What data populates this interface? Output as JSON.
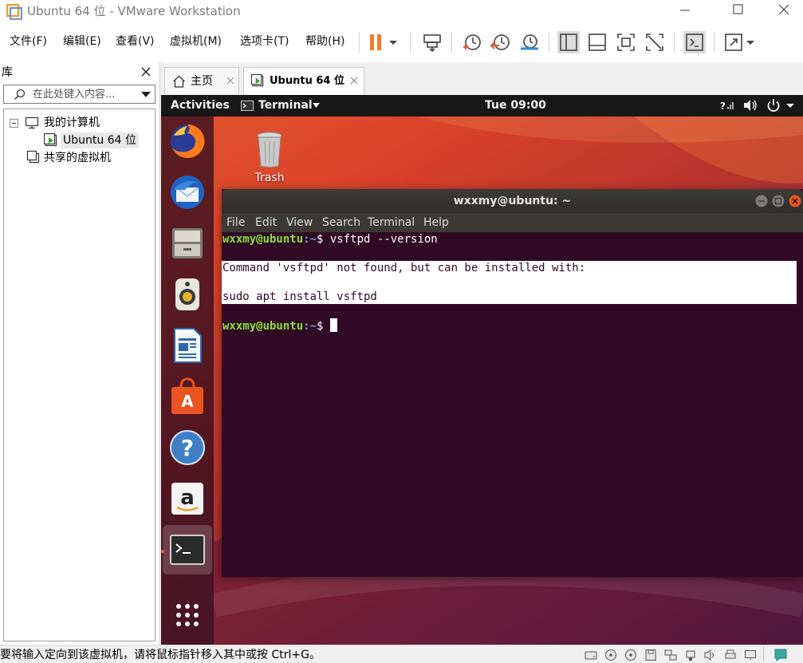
{
  "window": {
    "title": "Ubuntu 64 位 - VMware Workstation"
  },
  "menu": {
    "file": "文件(F)",
    "edit": "编辑(E)",
    "view": "查看(V)",
    "vm": "虚拟机(M)",
    "tabs": "选项卡(T)",
    "help": "帮助(H)"
  },
  "library": {
    "title": "库",
    "search_placeholder": "在此处键入内容...",
    "tree": {
      "my_computer": "我的计算机",
      "vm_item": "Ubuntu 64 位",
      "shared": "共享的虚拟机"
    }
  },
  "tabs": {
    "home": "主页",
    "vm": "Ubuntu 64 位"
  },
  "ubuntu": {
    "activities": "Activities",
    "app_menu": "Terminal",
    "clock": "Tue 09:00",
    "trash_label": "Trash"
  },
  "terminal": {
    "title": "wxxmy@ubuntu: ~",
    "menu": [
      "File",
      "Edit",
      "View",
      "Search",
      "Terminal",
      "Help"
    ],
    "prompt_user": "wxxmy@ubuntu",
    "prompt_path": ":~",
    "prompt_symbol": "$ ",
    "command": "vsftpd --version",
    "output_line1": "Command 'vsftpd' not found, but can be installed with:",
    "output_line2": "sudo apt install vsftpd"
  },
  "statusbar": {
    "message": "要将输入定向到该虚拟机，请将鼠标指针移入其中或按 Ctrl+G。"
  },
  "colors": {
    "terminal_bg": "#300a24",
    "prompt_user": "#8ae234",
    "prompt_path": "#729fcf",
    "ubuntu_orange": "#e95420",
    "pause_orange": "#f07b2e"
  }
}
